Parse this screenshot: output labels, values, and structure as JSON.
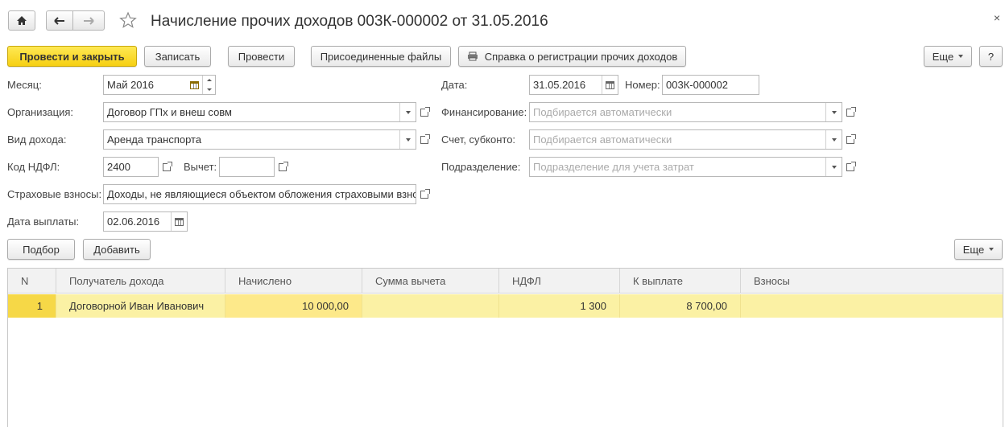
{
  "window": {
    "title": "Начисление прочих доходов 003К-000002 от 31.05.2016",
    "close_glyph": "×"
  },
  "toolbar": {
    "post_close": "Провести и закрыть",
    "save": "Записать",
    "post": "Провести",
    "attached_files": "Присоединенные файлы",
    "report": "Справка о регистрации прочих доходов",
    "more": "Еще",
    "help": "?"
  },
  "form": {
    "month": {
      "label": "Месяц:",
      "value": "Май 2016"
    },
    "date": {
      "label": "Дата:",
      "value": "31.05.2016"
    },
    "number": {
      "label": "Номер:",
      "value": "003К-000002"
    },
    "organization": {
      "label": "Организация:",
      "value": "Договор ГПх и внеш совм"
    },
    "financing": {
      "label": "Финансирование:",
      "placeholder": "Подбирается автоматически"
    },
    "income_type": {
      "label": "Вид дохода:",
      "value": "Аренда транспорта"
    },
    "account": {
      "label": "Счет, субконто:",
      "placeholder": "Подбирается автоматически"
    },
    "ndfl_code": {
      "label": "Код НДФЛ:",
      "value": "2400"
    },
    "deduction": {
      "label": "Вычет:",
      "value": ""
    },
    "department": {
      "label": "Подразделение:",
      "placeholder": "Подразделение для учета затрат"
    },
    "insurance": {
      "label": "Страховые взносы:",
      "value": "Доходы, не являющиеся объектом обложения страховыми взно"
    },
    "pay_date": {
      "label": "Дата выплаты:",
      "value": "02.06.2016"
    }
  },
  "table_toolbar": {
    "pick": "Подбор",
    "add": "Добавить",
    "more": "Еще"
  },
  "table": {
    "columns": [
      "N",
      "Получатель дохода",
      "Начислено",
      "Сумма вычета",
      "НДФЛ",
      "К выплате",
      "Взносы"
    ],
    "rows": [
      {
        "n": "1",
        "recipient": "Договорной Иван Иванович",
        "accrued": "10 000,00",
        "deduction": "",
        "ndfl": "1 300",
        "payout": "8 700,00",
        "contributions": ""
      }
    ]
  },
  "colors": {
    "primary_button": "#f6cf13",
    "selected_row": "#fbf1a4"
  }
}
